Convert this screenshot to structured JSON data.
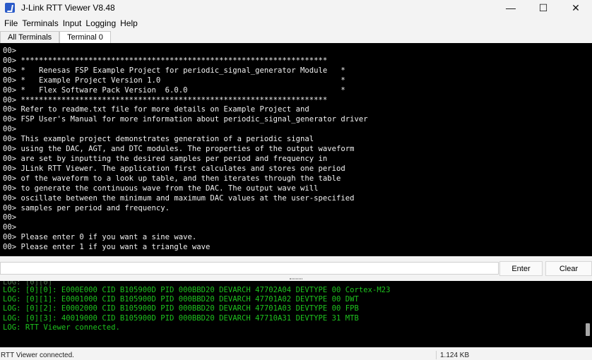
{
  "window": {
    "title": "J-Link RTT Viewer V8.48",
    "minimize": "—",
    "maximize": "☐",
    "close": "✕"
  },
  "menu": [
    "File",
    "Terminals",
    "Input",
    "Logging",
    "Help"
  ],
  "tabs": [
    {
      "label": "All Terminals",
      "active": false
    },
    {
      "label": "Terminal 0",
      "active": true
    }
  ],
  "terminal_lines": [
    "00>",
    "00> ********************************************************************",
    "00> *   Renesas FSP Example Project for periodic_signal_generator Module   *",
    "00> *   Example Project Version 1.0                                        *",
    "00> *   Flex Software Pack Version  6.0.0                                  *",
    "00> ********************************************************************",
    "00> Refer to readme.txt file for more details on Example Project and",
    "00> FSP User's Manual for more information about periodic_signal_generator driver",
    "00>",
    "00> This example project demonstrates generation of a periodic signal",
    "00> using the DAC, AGT, and DTC modules. The properties of the output waveform",
    "00> are set by inputting the desired samples per period and frequency in",
    "00> JLink RTT Viewer. The application first calculates and stores one period",
    "00> of the waveform to a look up table, and then iterates through the table",
    "00> to generate the continuous wave from the DAC. The output wave will",
    "00> oscillate between the minimum and maximum DAC values at the user-specified",
    "00> samples per period and frequency.",
    "00>",
    "00>",
    "00> Please enter 0 if you want a sine wave.",
    "00> Please enter 1 if you want a triangle wave"
  ],
  "input": {
    "value": "",
    "enter_label": "Enter",
    "clear_label": "Clear"
  },
  "log_lines": [
    "LOG: [0][0]: E000E000 CID B105900D PID 000BBD20 DEVARCH 47702A04 DEVTYPE 00 Cortex-M23",
    "LOG: [0][1]: E0001000 CID B105900D PID 000BBD20 DEVARCH 47701A02 DEVTYPE 00 DWT",
    "LOG: [0][2]: E0002000 CID B105900D PID 000BBD20 DEVARCH 47701A03 DEVTYPE 00 FPB",
    "LOG: [0][3]: 40019000 CID B105900D PID 000BBD20 DEVARCH 47710A31 DEVTYPE 31 MTB",
    "LOG: RTT Viewer connected."
  ],
  "status": {
    "left": "RTT Viewer connected.",
    "right": "1.124 KB"
  },
  "colors": {
    "terminal_bg": "#000000",
    "terminal_text": "#f0f0f0",
    "log_text": "#1ec21e"
  }
}
